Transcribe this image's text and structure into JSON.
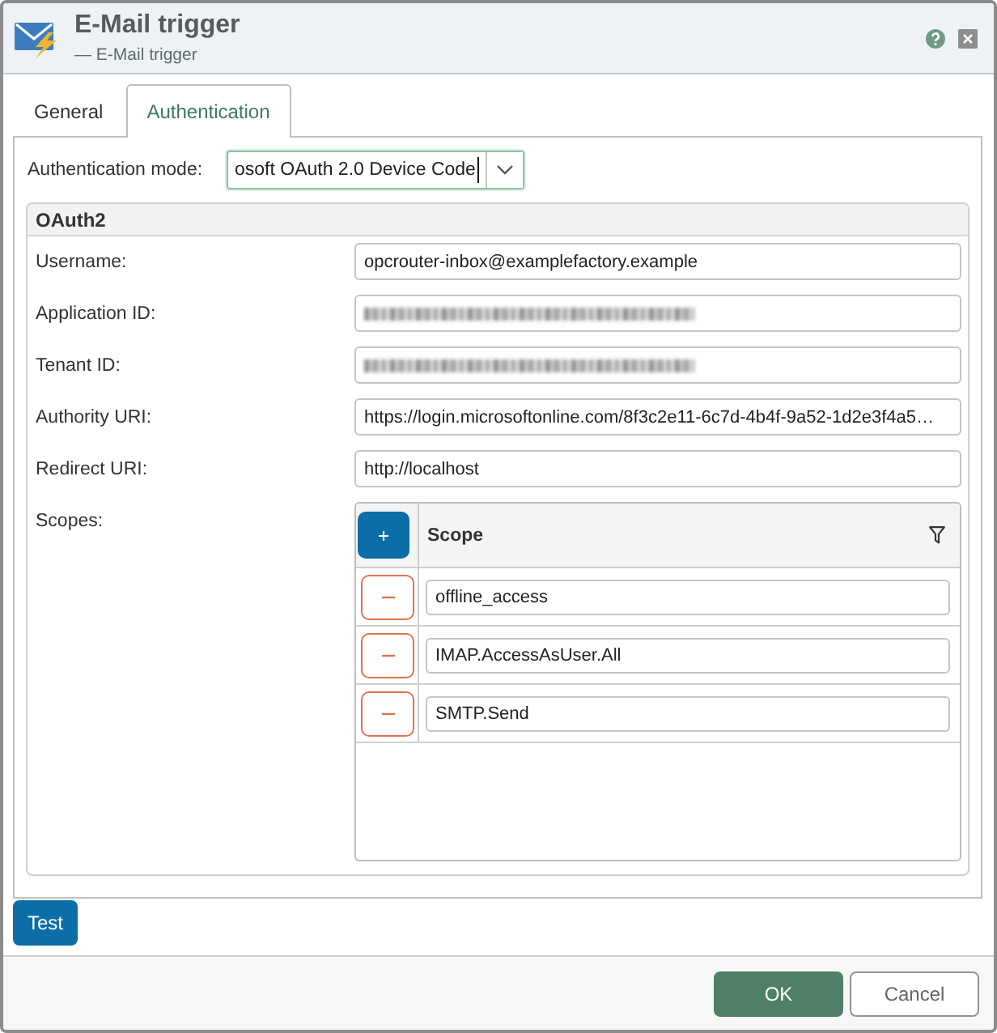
{
  "window": {
    "title": "E-Mail trigger",
    "subtitle": "— E-Mail trigger"
  },
  "tabs": [
    {
      "label": "General",
      "selected": false
    },
    {
      "label": "Authentication",
      "selected": true
    }
  ],
  "auth_mode": {
    "label": "Authentication mode:",
    "value": "osoft OAuth 2.0 Device Code",
    "focused": true
  },
  "oauth2": {
    "title": "OAuth2",
    "fields": [
      {
        "label": "Username:",
        "value": "opcrouter-inbox@examplefactory.example",
        "redacted": false
      },
      {
        "label": "Application ID:",
        "redacted": true
      },
      {
        "label": "Tenant ID:",
        "redacted": true
      },
      {
        "label": "Authority URI:",
        "value": "https://login.microsoftonline.com/8f3c2e11-6c7d-4b4f-9a52-1d2e3f4a5…",
        "redacted": false
      },
      {
        "label": "Redirect URI:",
        "value": "http://localhost",
        "redacted": false
      }
    ],
    "scopes": {
      "label": "Scopes:",
      "column": "Scope",
      "rows": [
        {
          "value": "offline_access"
        },
        {
          "value": "IMAP.AccessAsUser.All"
        },
        {
          "value": "SMTP.Send"
        }
      ]
    }
  },
  "test_button": "Test",
  "footer_buttons": [
    {
      "label": "OK",
      "kind": "primary"
    },
    {
      "label": "Cancel",
      "kind": "secondary"
    }
  ]
}
